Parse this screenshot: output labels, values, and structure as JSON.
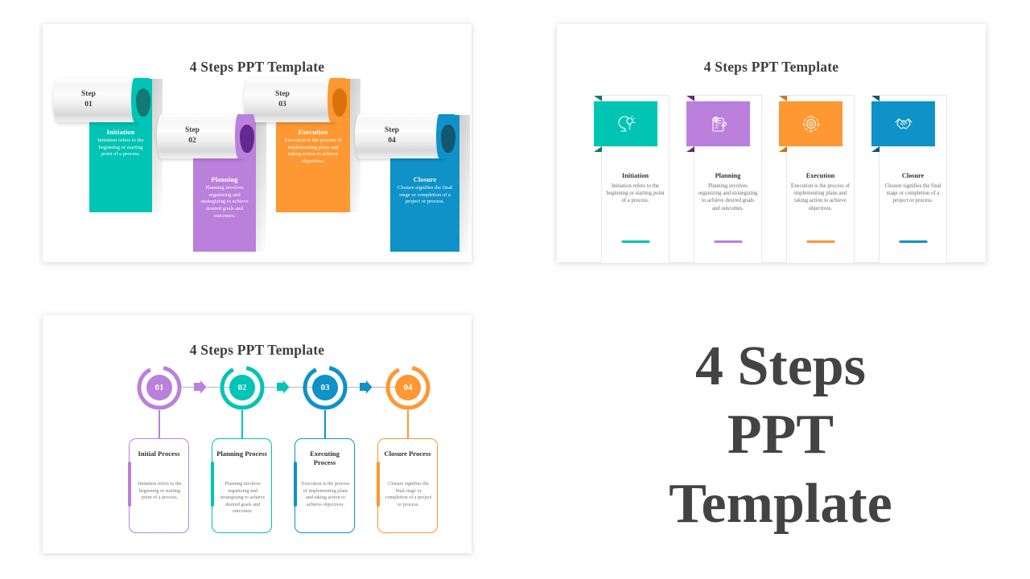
{
  "theme": {
    "teal": "#00C4B4",
    "teal_dark": "#117A72",
    "purple": "#BB7FDC",
    "purple_dark": "#65288E",
    "orange": "#FD9832",
    "orange_dark": "#D9720A",
    "blue": "#0E92C8",
    "blue_dark": "#12566F",
    "text_dark": "#3d3d3d",
    "text_muted": "#6a6a6a",
    "connector": "#b9b9b9"
  },
  "headline": {
    "line1": "4 Steps",
    "line2": "PPT",
    "line3": "Template"
  },
  "panel1": {
    "title": "4 Steps PPT Template",
    "steps": [
      {
        "step_word": "Step",
        "step_number": "01",
        "title": "Initiation",
        "desc": "Initiation refers to the beginning or starting point of a process.",
        "color": "#00C4B4",
        "fold_color": "#117A72"
      },
      {
        "step_word": "Step",
        "step_number": "02",
        "title": "Planning",
        "desc": "Planning involves organizing and strategizing to achieve desired goals and outcomes.",
        "color": "#BB7FDC",
        "fold_color": "#65288E"
      },
      {
        "step_word": "Step",
        "step_number": "03",
        "title": "Execution",
        "desc": "Execution is the process of implementing plans and taking action to achieve objectives.",
        "color": "#FD9832",
        "fold_color": "#D9720A"
      },
      {
        "step_word": "Step",
        "step_number": "04",
        "title": "Closure",
        "desc": "Closure signifies the final stage or completion of a project or process.",
        "color": "#0E92C8",
        "fold_color": "#12566F"
      }
    ]
  },
  "panel2": {
    "title": "4 Steps PPT Template",
    "cards": [
      {
        "icon": "head-lightbulb-icon",
        "title": "Initiation",
        "desc": "Initiation refers to the beginning or starting point of a process.",
        "color": "#00C4B4",
        "fold_color": "#117A72"
      },
      {
        "icon": "clipboard-gear-icon",
        "title": "Planning",
        "desc": "Planning involves organizing and strategizing to achieve desired goals and outcomes.",
        "color": "#BB7FDC",
        "fold_color": "#65288E"
      },
      {
        "icon": "target-gear-icon",
        "title": "Execution",
        "desc": "Execution is the process of implementing plans and taking action to achieve objectives.",
        "color": "#FD9832",
        "fold_color": "#D9720A"
      },
      {
        "icon": "handshake-icon",
        "title": "Closure",
        "desc": "Closure signifies the final stage or completion of a project or process.",
        "color": "#0E92C8",
        "fold_color": "#12566F"
      }
    ]
  },
  "panel3": {
    "title": "4 Steps PPT Template",
    "nodes": [
      {
        "number": "01",
        "title": "Initial Process",
        "desc": "Initiation refers to the beginning or starting point of a process.",
        "color": "#BB7FDC"
      },
      {
        "number": "02",
        "title": "Planning Process",
        "desc": "Planning involves organizing and strategizing to achieve desired goals and outcomes.",
        "color": "#00C4B4"
      },
      {
        "number": "03",
        "title": "Executing Process",
        "desc": "Execution is the process of implementing plans and taking action to achieve objectives.",
        "color": "#0E92C8"
      },
      {
        "number": "04",
        "title": "Closure Process",
        "desc": "Closure signifies the final stage or completion of a project or process.",
        "color": "#FD9832"
      }
    ]
  }
}
